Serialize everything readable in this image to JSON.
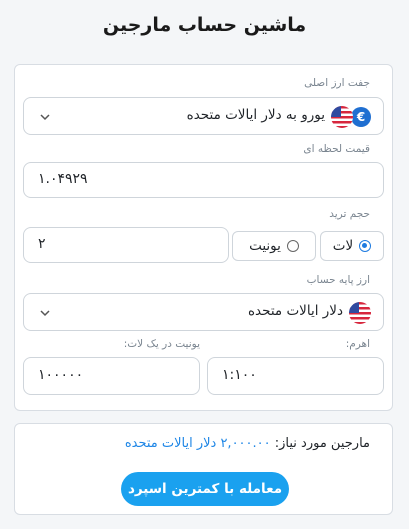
{
  "page": {
    "title": "ماشین حساب مارجین"
  },
  "form": {
    "pair": {
      "label": "جفت ارز اصلی",
      "value": "یورو به دلار ایالات متحده",
      "icon": "euro-usd-flag-icon"
    },
    "price": {
      "label": "قیمت لحظه ای",
      "value": "۱.۰۴۹۲۹"
    },
    "volume": {
      "label": "حجم ترید",
      "value": "۲",
      "options": [
        {
          "label": "لات",
          "selected": true
        },
        {
          "label": "یونیت",
          "selected": false
        }
      ]
    },
    "account_currency": {
      "label": "ارز پایه حساب",
      "value": "دلار ایالات متحده",
      "icon": "usa-flag-icon"
    },
    "leverage": {
      "label": "اهرم:",
      "value": "۱:۱۰۰"
    },
    "units_per_lot": {
      "label": "یونیت در یک لات:",
      "value": "۱۰۰۰۰۰"
    }
  },
  "result": {
    "label": "مارجین مورد نیاز:",
    "value": "۲,۰۰۰.۰۰ دلار ایالات متحده"
  },
  "cta": {
    "label": "معامله با کمترین اسپرد"
  },
  "colors": {
    "accent": "#1aa1ef",
    "link": "#1e86e6",
    "radio": "#1e7be0"
  }
}
